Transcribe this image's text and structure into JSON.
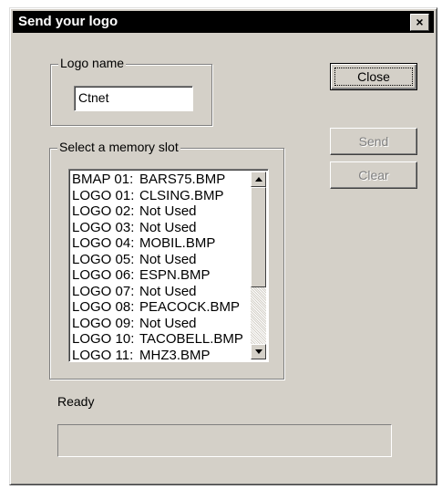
{
  "window": {
    "title": "Send your logo",
    "close_glyph": "×"
  },
  "logo_name": {
    "legend": "Logo name",
    "value": "Ctnet"
  },
  "memory": {
    "legend": "Select a memory slot",
    "items": [
      {
        "slot": "BMAP 01:",
        "file": "BARS75.BMP"
      },
      {
        "slot": "LOGO 01:",
        "file": "CLSING.BMP"
      },
      {
        "slot": "LOGO 02:",
        "file": "Not Used"
      },
      {
        "slot": "LOGO 03:",
        "file": "Not Used"
      },
      {
        "slot": "LOGO 04:",
        "file": "MOBIL.BMP"
      },
      {
        "slot": "LOGO 05:",
        "file": "Not Used"
      },
      {
        "slot": "LOGO 06:",
        "file": "ESPN.BMP"
      },
      {
        "slot": "LOGO 07:",
        "file": "Not Used"
      },
      {
        "slot": "LOGO 08:",
        "file": "PEACOCK.BMP"
      },
      {
        "slot": "LOGO 09:",
        "file": "Not Used"
      },
      {
        "slot": "LOGO 10:",
        "file": "TACOBELL.BMP"
      },
      {
        "slot": "LOGO 11:",
        "file": "MHZ3.BMP"
      }
    ]
  },
  "buttons": {
    "close": "Close",
    "send": "Send",
    "clear": "Clear"
  },
  "status": {
    "text": "Ready",
    "progress": 0
  },
  "icons": {
    "scroll_up": "scroll-up-arrow-icon",
    "scroll_down": "scroll-down-arrow-icon"
  }
}
